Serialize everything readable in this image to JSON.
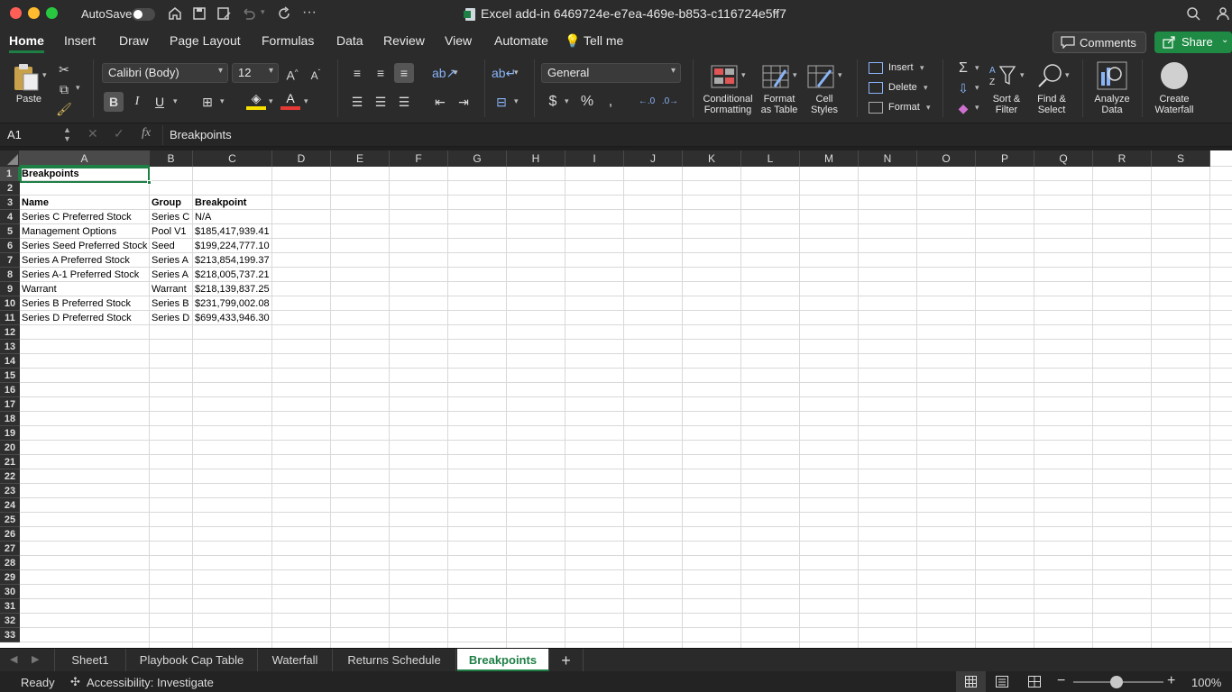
{
  "title_bar": {
    "autosave_label": "AutoSave",
    "doc_title": "Excel add-in 6469724e-e7ea-469e-b853-c116724e5ff7"
  },
  "ribbon_tabs": [
    "Home",
    "Insert",
    "Draw",
    "Page Layout",
    "Formulas",
    "Data",
    "Review",
    "View",
    "Automate"
  ],
  "tell_me": "Tell me",
  "comments_label": "Comments",
  "share_label": "Share",
  "ribbon": {
    "paste": "Paste",
    "font_name": "Calibri (Body)",
    "font_size": "12",
    "number_format": "General",
    "cond_fmt": [
      "Conditional",
      "Formatting"
    ],
    "fmt_table": [
      "Format",
      "as Table"
    ],
    "cell_styles": [
      "Cell",
      "Styles"
    ],
    "insert": "Insert",
    "delete": "Delete",
    "format": "Format",
    "sort_filter": [
      "Sort &",
      "Filter"
    ],
    "find_select": [
      "Find &",
      "Select"
    ],
    "analyze": [
      "Analyze",
      "Data"
    ],
    "waterfall": [
      "Create",
      "Waterfall"
    ],
    "bold": "B",
    "italic": "I",
    "underline": "U"
  },
  "formula_bar": {
    "name_box": "A1",
    "formula": "Breakpoints"
  },
  "columns": [
    "A",
    "B",
    "C",
    "D",
    "E",
    "F",
    "G",
    "H",
    "I",
    "J",
    "K",
    "L",
    "M",
    "N",
    "O",
    "P",
    "Q",
    "R",
    "S"
  ],
  "rows": [
    "1",
    "2",
    "3",
    "4",
    "5",
    "6",
    "7",
    "8",
    "9",
    "10",
    "11",
    "12",
    "13",
    "14",
    "15",
    "16",
    "17",
    "18",
    "19",
    "20",
    "21",
    "22",
    "23",
    "24",
    "25",
    "26",
    "27",
    "28",
    "29",
    "30",
    "31",
    "32",
    "33"
  ],
  "sheet": {
    "a1": "Breakpoints",
    "headers": [
      "Name",
      "Group",
      "Breakpoint"
    ],
    "data": [
      [
        "Series C Preferred Stock",
        "Series C",
        "N/A"
      ],
      [
        "Management Options",
        "Pool V1",
        "$185,417,939.41"
      ],
      [
        "Series Seed Preferred Stock",
        "Seed",
        "$199,224,777.10"
      ],
      [
        "Series A Preferred Stock",
        "Series A",
        "$213,854,199.37"
      ],
      [
        "Series A-1 Preferred Stock",
        "Series A",
        "$218,005,737.21"
      ],
      [
        "Warrant",
        "Warrant",
        "$218,139,837.25"
      ],
      [
        "Series B Preferred Stock",
        "Series B",
        "$231,799,002.08"
      ],
      [
        "Series D Preferred Stock",
        "Series D",
        "$699,433,946.30"
      ]
    ]
  },
  "sheet_tabs": [
    "Sheet1",
    "Playbook Cap Table",
    "Waterfall",
    "Returns Schedule",
    "Breakpoints"
  ],
  "active_tab": "Breakpoints",
  "status": {
    "ready": "Ready",
    "accessibility": "Accessibility: Investigate",
    "zoom": "100%"
  },
  "colors": {
    "accent": "#1e7f45",
    "share_bg": "#1e8a44"
  }
}
